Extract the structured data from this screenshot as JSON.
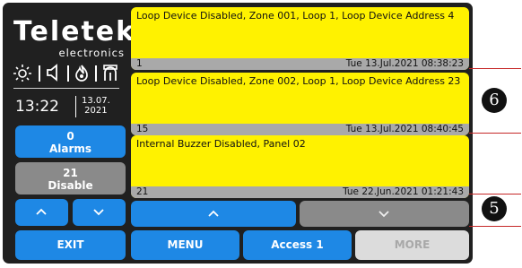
{
  "brand": {
    "name": "Teletek",
    "sub": "electronics"
  },
  "status_icons": [
    "sun-icon",
    "speaker-icon",
    "fire-icon",
    "alarm-tower-icon"
  ],
  "clock": {
    "time": "13:22",
    "date_top": "13.07.",
    "date_bottom": "2021"
  },
  "sidebar": {
    "alarms": {
      "count": "0",
      "label": "Alarms"
    },
    "disable": {
      "count": "21",
      "label": "Disable"
    },
    "up_icon": "chevron-up-icon",
    "down_icon": "chevron-down-icon",
    "exit_label": "EXIT"
  },
  "events": [
    {
      "message": "Loop Device Disabled, Zone 001, Loop 1, Loop Device Address 4",
      "number": "1",
      "timestamp": "Tue 13.Jul.2021 08:38:23"
    },
    {
      "message": "Loop Device Disabled, Zone 002, Loop 1, Loop Device Address 23",
      "number": "15",
      "timestamp": "Tue 13.Jul.2021 08:40:45"
    },
    {
      "message": "Internal Buzzer Disabled, Panel 02",
      "number": "21",
      "timestamp": "Tue 22.Jun.2021 01:21:43"
    }
  ],
  "list_nav": {
    "up_icon": "chevron-up-icon",
    "down_icon": "chevron-down-icon"
  },
  "bottom_bar": {
    "menu": "MENU",
    "access": "Access 1",
    "more": "MORE"
  },
  "callouts": {
    "six": "6",
    "five": "5"
  },
  "colors": {
    "accent_blue": "#1e88e5",
    "event_yellow": "#fff200",
    "disabled_grey": "#8a8a8a",
    "callout_red": "#c62828",
    "screen": "#202020"
  }
}
